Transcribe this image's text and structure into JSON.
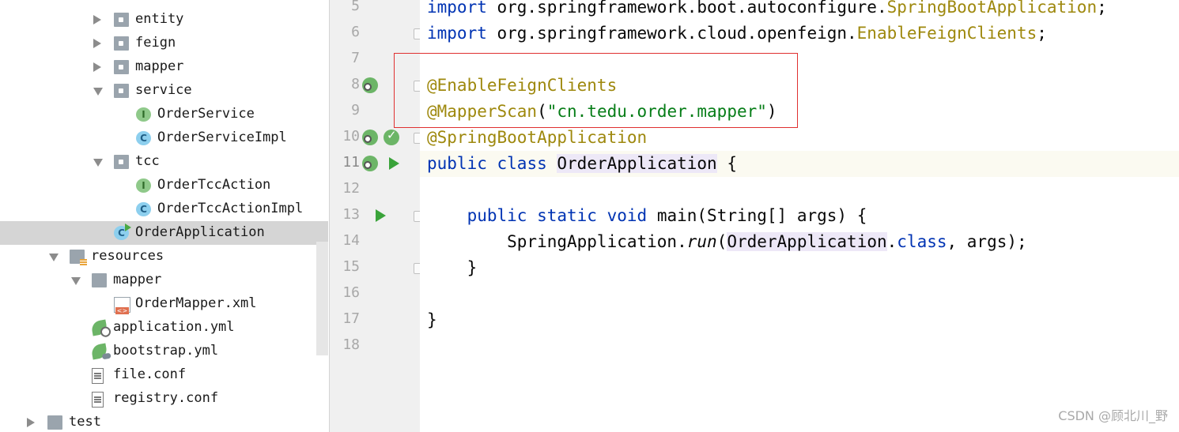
{
  "tree": {
    "items": [
      {
        "label": "entity",
        "icon": "package-folder-icon",
        "expanded": false
      },
      {
        "label": "feign",
        "icon": "package-folder-icon",
        "expanded": false
      },
      {
        "label": "mapper",
        "icon": "package-folder-icon",
        "expanded": false
      },
      {
        "label": "service",
        "icon": "package-folder-icon",
        "expanded": true
      },
      {
        "label": "OrderService",
        "icon": "interface-icon",
        "glyph": "I"
      },
      {
        "label": "OrderServiceImpl",
        "icon": "class-icon",
        "glyph": "C"
      },
      {
        "label": "tcc",
        "icon": "package-folder-icon",
        "expanded": true
      },
      {
        "label": "OrderTccAction",
        "icon": "interface-icon",
        "glyph": "I"
      },
      {
        "label": "OrderTccActionImpl",
        "icon": "class-icon",
        "glyph": "C"
      },
      {
        "label": "OrderApplication",
        "icon": "spring-boot-class-icon",
        "glyph": "C",
        "selected": true
      },
      {
        "label": "resources",
        "icon": "resources-folder-icon",
        "expanded": true
      },
      {
        "label": "mapper",
        "icon": "folder-icon",
        "expanded": true
      },
      {
        "label": "OrderMapper.xml",
        "icon": "xml-file-icon"
      },
      {
        "label": "application.yml",
        "icon": "spring-config-icon"
      },
      {
        "label": "bootstrap.yml",
        "icon": "spring-cloud-config-icon"
      },
      {
        "label": "file.conf",
        "icon": "text-file-icon"
      },
      {
        "label": "registry.conf",
        "icon": "text-file-icon"
      },
      {
        "label": "test",
        "icon": "folder-icon",
        "expanded": false
      }
    ]
  },
  "editor": {
    "line_numbers": [
      "5",
      "6",
      "7",
      "8",
      "9",
      "10",
      "11",
      "12",
      "13",
      "14",
      "15",
      "16",
      "17",
      "18"
    ],
    "current_line": "11",
    "lines": [
      {
        "tokens": [
          {
            "t": "import",
            "c": "kw"
          },
          {
            "t": " org.springframework.boot.autoconfigure.",
            "c": ""
          },
          {
            "t": "SpringBootApplication",
            "c": "ann"
          },
          {
            "t": ";",
            "c": ""
          }
        ]
      },
      {
        "tokens": [
          {
            "t": "import",
            "c": "kw"
          },
          {
            "t": " org.springframework.cloud.openfeign.",
            "c": ""
          },
          {
            "t": "EnableFeignClients",
            "c": "ann"
          },
          {
            "t": ";",
            "c": ""
          }
        ]
      },
      {
        "tokens": []
      },
      {
        "tokens": [
          {
            "t": "@EnableFeignClients",
            "c": "ann"
          }
        ]
      },
      {
        "tokens": [
          {
            "t": "@MapperScan",
            "c": "ann"
          },
          {
            "t": "(",
            "c": ""
          },
          {
            "t": "\"cn.",
            "c": "str"
          },
          {
            "t": "tedu",
            "c": "str uw"
          },
          {
            "t": ".order.mapper\"",
            "c": "str"
          },
          {
            "t": ")",
            "c": ""
          }
        ]
      },
      {
        "tokens": [
          {
            "t": "@SpringBootApplication",
            "c": "ann"
          }
        ]
      },
      {
        "tokens": [
          {
            "t": "public",
            "c": "kw"
          },
          {
            "t": " ",
            "c": ""
          },
          {
            "t": "class",
            "c": "kw"
          },
          {
            "t": " ",
            "c": ""
          },
          {
            "t": "OrderApplication",
            "c": "hl"
          },
          {
            "t": " {",
            "c": ""
          }
        ]
      },
      {
        "tokens": []
      },
      {
        "tokens": [
          {
            "t": "    ",
            "c": ""
          },
          {
            "t": "public",
            "c": "kw"
          },
          {
            "t": " ",
            "c": ""
          },
          {
            "t": "static",
            "c": "kw"
          },
          {
            "t": " ",
            "c": ""
          },
          {
            "t": "void",
            "c": "kw"
          },
          {
            "t": " main(String[] args) {",
            "c": ""
          }
        ]
      },
      {
        "tokens": [
          {
            "t": "        SpringApplication.",
            "c": ""
          },
          {
            "t": "run",
            "c": "ital"
          },
          {
            "t": "(",
            "c": ""
          },
          {
            "t": "OrderApplication",
            "c": "hl"
          },
          {
            "t": ".",
            "c": ""
          },
          {
            "t": "class",
            "c": "kw"
          },
          {
            "t": ", args);",
            "c": ""
          }
        ]
      },
      {
        "tokens": [
          {
            "t": "    }",
            "c": ""
          }
        ]
      },
      {
        "tokens": []
      },
      {
        "tokens": [
          {
            "t": "}",
            "c": ""
          }
        ]
      },
      {
        "tokens": []
      }
    ]
  },
  "gutter_icons": {
    "8": [
      "spring-bean-icon"
    ],
    "10": [
      "spring-bean-icon",
      "spring-bean-check-icon"
    ],
    "11": [
      "spring-bean-icon",
      "run-icon"
    ],
    "13": [
      "run-icon"
    ]
  },
  "watermark": "CSDN @顾北川_野",
  "colors": {
    "keyword": "#0033b3",
    "annotation": "#9e880d",
    "string": "#067d17",
    "highlight_box": "#e03030",
    "selection": "#d5d5d5"
  }
}
